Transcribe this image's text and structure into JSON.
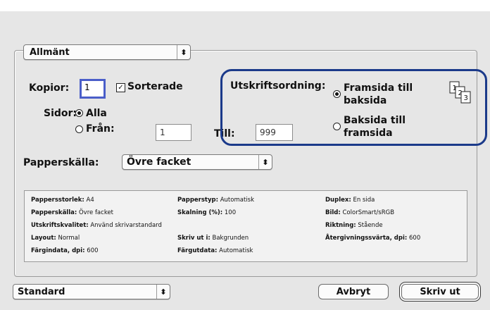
{
  "section_popup": {
    "label": "Allmänt"
  },
  "copies": {
    "label": "Kopior:",
    "value": "1",
    "collated_label": "Sorterade",
    "collated": true
  },
  "pages": {
    "label": "Sidor:",
    "all_label": "Alla",
    "from_label": "Från:",
    "from_value": "1",
    "to_label": "Till:",
    "to_value": "999"
  },
  "print_order": {
    "label": "Utskriftsordning:",
    "front_to_back_line1": "Framsida till",
    "front_to_back_line2": "baksida",
    "back_to_front_line1": "Baksida till",
    "back_to_front_line2": "framsida",
    "selected": "front_to_back",
    "icon": "page-order-icon"
  },
  "paper_source": {
    "label": "Papperskälla:",
    "value": "Övre facket"
  },
  "summary": {
    "rows": [
      [
        {
          "key": "Pappersstorlek:",
          "value": "A4"
        },
        {
          "key": "Papperstyp:",
          "value": "Automatisk"
        },
        {
          "key": "Duplex:",
          "value": "En sida"
        }
      ],
      [
        {
          "key": "Papperskälla:",
          "value": "Övre facket"
        },
        {
          "key": "Skalning (%):",
          "value": "100"
        },
        {
          "key": "Bild:",
          "value": "ColorSmart/sRGB"
        }
      ],
      [
        {
          "key": "Utskriftskvalitet:",
          "value": "Använd skrivarstandard"
        },
        {
          "key": "",
          "value": ""
        },
        {
          "key": "Riktning:",
          "value": "Stående"
        }
      ],
      [
        {
          "key": "Layout:",
          "value": "Normal"
        },
        {
          "key": "Skriv ut i:",
          "value": "Bakgrunden"
        },
        {
          "key": "Återgivningssvärta, dpi:",
          "value": "600"
        }
      ],
      [
        {
          "key": "Färgindata, dpi:",
          "value": "600"
        },
        {
          "key": "Färgutdata:",
          "value": "Automatisk"
        },
        {
          "key": "",
          "value": ""
        }
      ]
    ]
  },
  "preset_popup": {
    "label": "Standard"
  },
  "buttons": {
    "cancel": "Avbryt",
    "print": "Skriv ut"
  },
  "popup_arrows": "⇕"
}
